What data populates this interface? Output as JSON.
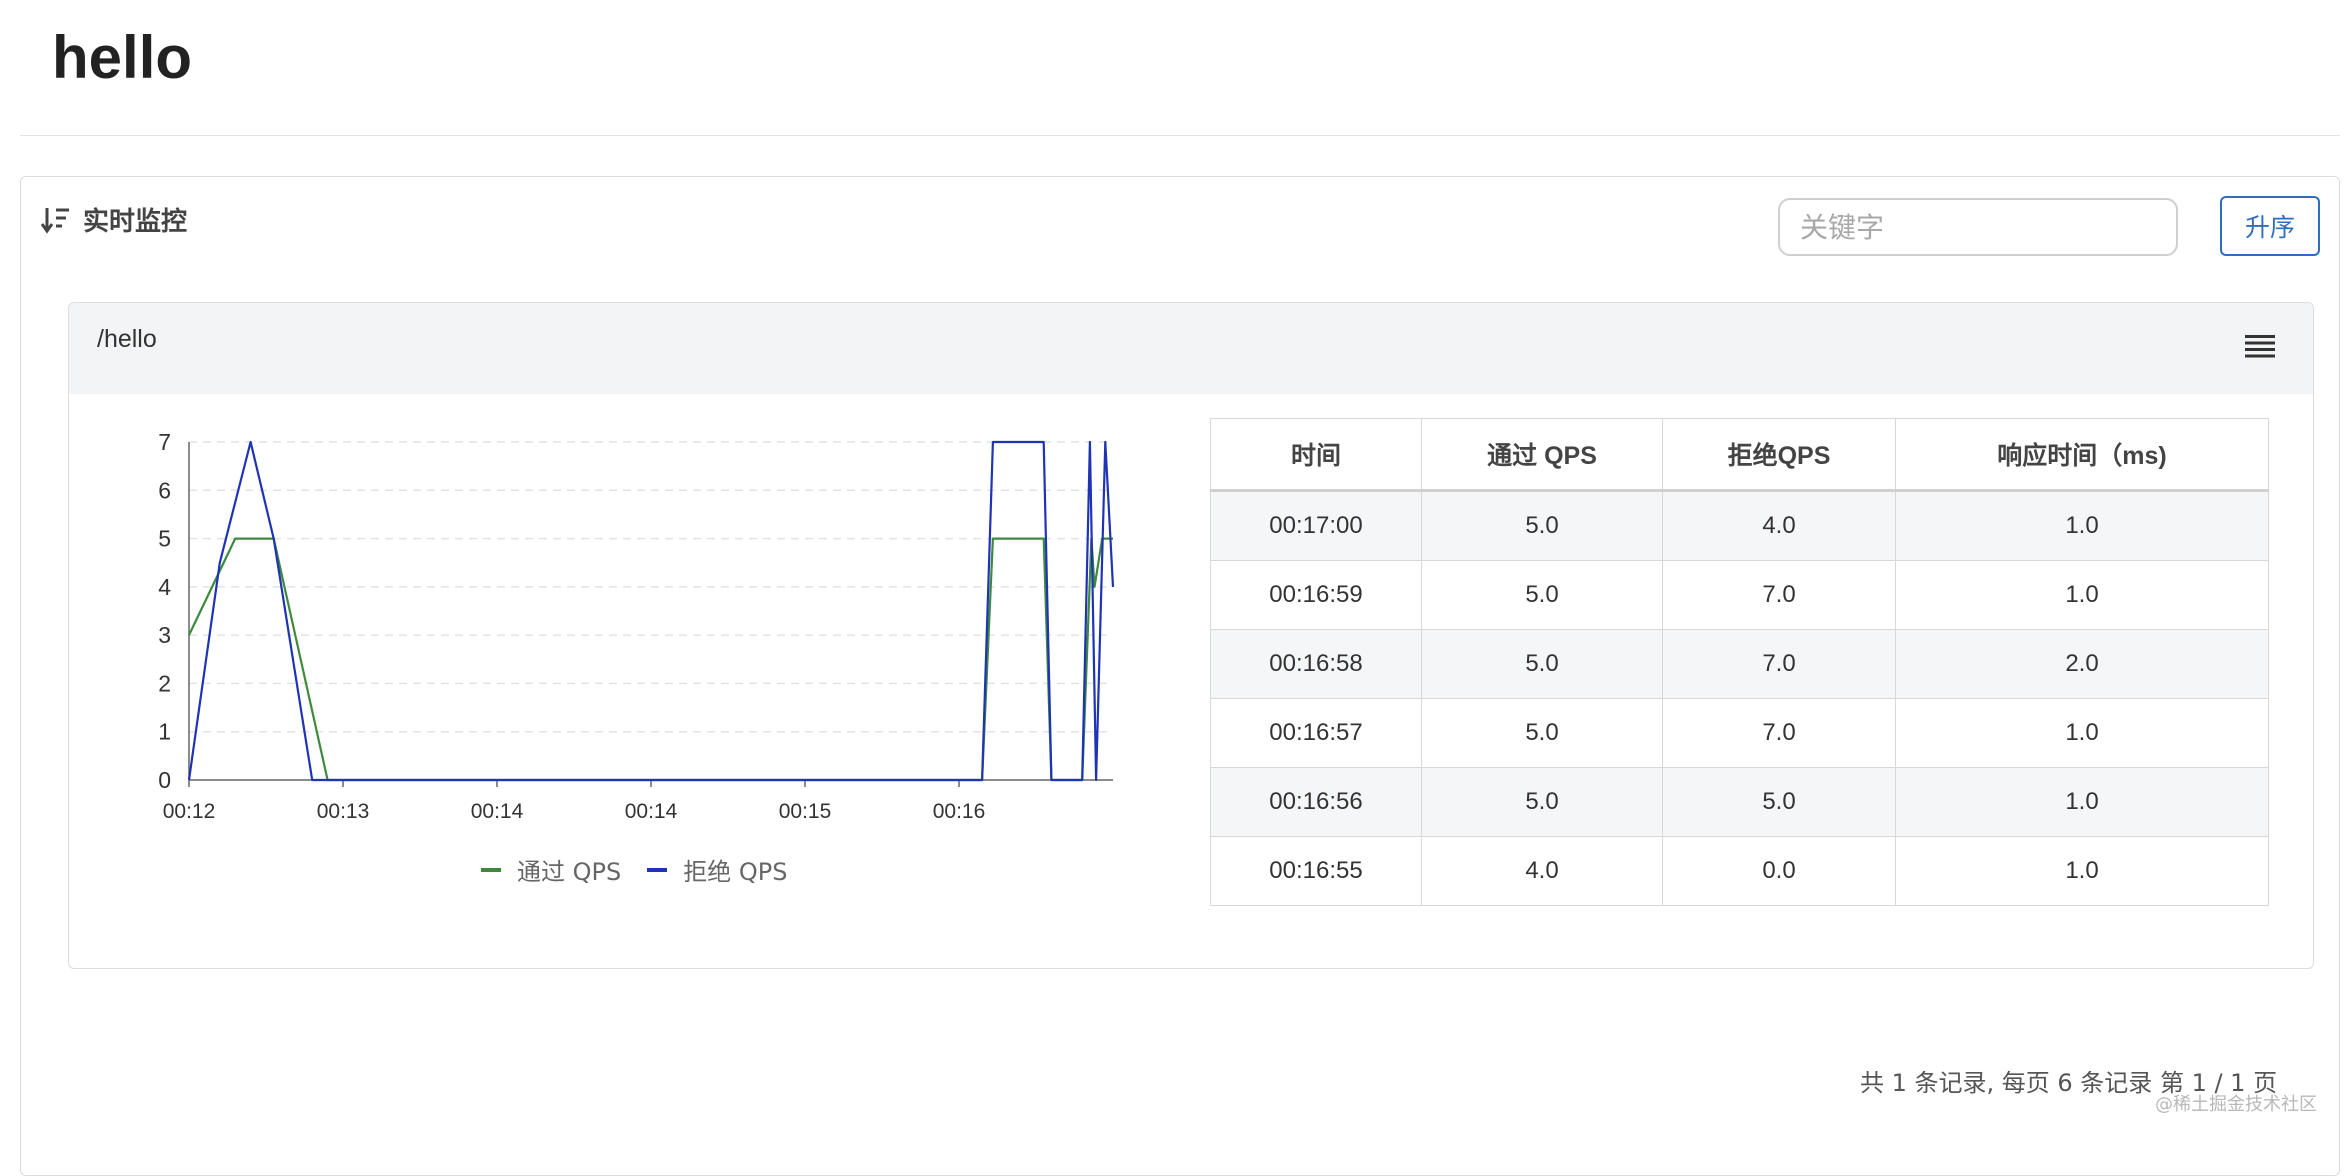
{
  "page": {
    "title": "hello"
  },
  "monitor": {
    "section_title": "实时监控",
    "search": {
      "placeholder": "关键字",
      "value": ""
    },
    "sort_button_label": "升序",
    "sort_icon": "sort-descending-icon"
  },
  "resource": {
    "name": "/hello",
    "menu_icon": "menu-icon"
  },
  "chart_data": {
    "type": "line",
    "x_tick_labels": [
      "00:12",
      "00:13",
      "00:14",
      "00:14",
      "00:15",
      "00:16"
    ],
    "ylim": [
      0,
      7
    ],
    "y_ticks": [
      0,
      1,
      2,
      3,
      4,
      5,
      6,
      7
    ],
    "grid": "horizontal-dashed",
    "legend": "bottom",
    "colors": {
      "pass": "#3d8a3d",
      "block": "#1f33b5"
    },
    "series": [
      {
        "name": "通过 QPS",
        "points": [
          [
            0.0,
            3
          ],
          [
            0.3,
            5
          ],
          [
            0.55,
            5
          ],
          [
            0.9,
            0
          ],
          [
            5.15,
            0
          ],
          [
            5.22,
            5
          ],
          [
            5.55,
            5
          ],
          [
            5.6,
            0
          ],
          [
            5.8,
            0
          ],
          [
            5.86,
            5
          ],
          [
            5.88,
            4
          ],
          [
            5.93,
            5
          ],
          [
            6.0,
            5
          ]
        ]
      },
      {
        "name": "拒绝 QPS",
        "points": [
          [
            0.0,
            0
          ],
          [
            0.2,
            4.5
          ],
          [
            0.4,
            7
          ],
          [
            0.55,
            5
          ],
          [
            0.8,
            0
          ],
          [
            5.15,
            0
          ],
          [
            5.22,
            7
          ],
          [
            5.55,
            7
          ],
          [
            5.6,
            0
          ],
          [
            5.8,
            0
          ],
          [
            5.85,
            7
          ],
          [
            5.89,
            0
          ],
          [
            5.95,
            7
          ],
          [
            6.0,
            4
          ]
        ]
      }
    ]
  },
  "table": {
    "headers": [
      "时间",
      "通过 QPS",
      "拒绝QPS",
      "响应时间（ms)"
    ],
    "rows": [
      [
        "00:17:00",
        "5.0",
        "4.0",
        "1.0"
      ],
      [
        "00:16:59",
        "5.0",
        "7.0",
        "1.0"
      ],
      [
        "00:16:58",
        "5.0",
        "7.0",
        "2.0"
      ],
      [
        "00:16:57",
        "5.0",
        "7.0",
        "1.0"
      ],
      [
        "00:16:56",
        "5.0",
        "5.0",
        "1.0"
      ],
      [
        "00:16:55",
        "4.0",
        "0.0",
        "1.0"
      ]
    ]
  },
  "pagination": {
    "text": "共 1 条记录, 每页 6 条记录 第 1 / 1 页"
  },
  "watermark": "@稀土掘金技术社区"
}
